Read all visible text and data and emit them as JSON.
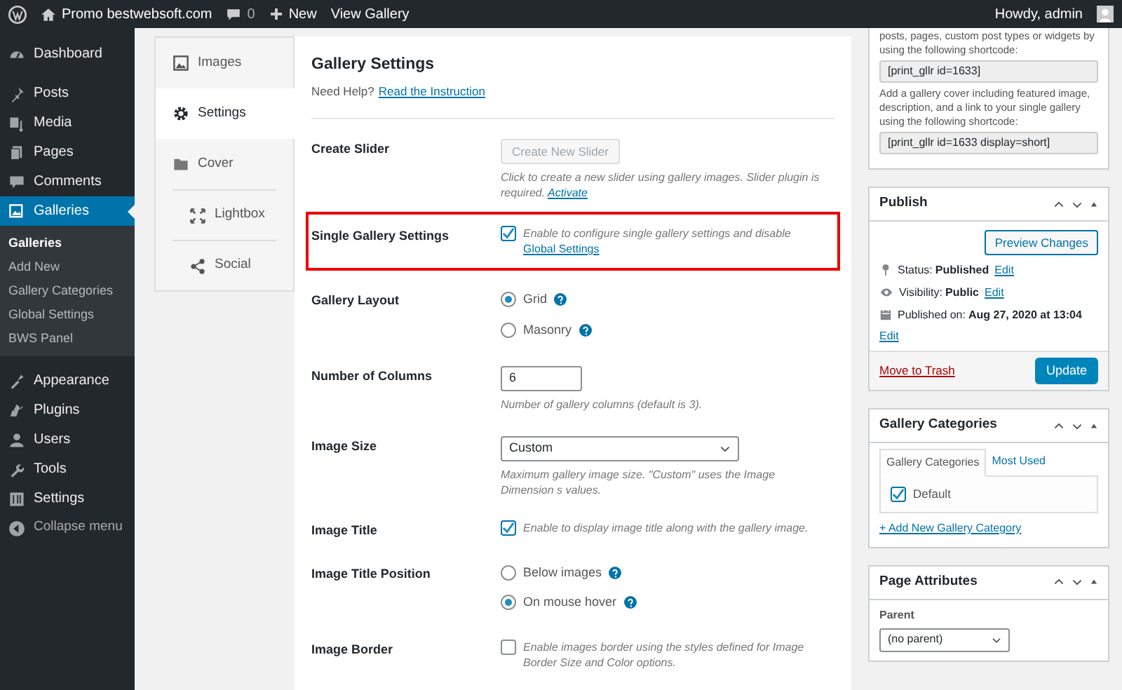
{
  "admin_bar": {
    "site": "Promo bestwebsoft.com",
    "comments": "0",
    "new": "New",
    "view": "View Gallery",
    "greeting": "Howdy, admin"
  },
  "menu_groups": [
    [
      {
        "label": "Dashboard",
        "selected": false
      }
    ],
    [
      {
        "label": "Posts",
        "selected": false
      },
      {
        "label": "Media",
        "selected": false
      },
      {
        "label": "Pages",
        "selected": false
      },
      {
        "label": "Comments",
        "selected": false
      },
      {
        "label": "Galleries",
        "selected": true,
        "children": [
          {
            "label": "Galleries",
            "selected": true
          },
          {
            "label": "Add New",
            "selected": false
          },
          {
            "label": "Gallery Categories",
            "selected": false
          },
          {
            "label": "Global Settings",
            "selected": false
          },
          {
            "label": "BWS Panel",
            "selected": false
          }
        ]
      }
    ],
    [
      {
        "label": "Appearance",
        "selected": false
      },
      {
        "label": "Plugins",
        "selected": false
      },
      {
        "label": "Users",
        "selected": false
      },
      {
        "label": "Tools",
        "selected": false
      },
      {
        "label": "Settings",
        "selected": false
      }
    ]
  ],
  "collapse": "Collapse menu",
  "tabs": [
    {
      "label": "Images",
      "selected": false
    },
    {
      "label": "Settings",
      "selected": true
    },
    {
      "label": "Cover",
      "selected": false
    },
    {
      "label": "Lightbox",
      "selected": false
    },
    {
      "label": "Social",
      "selected": false
    }
  ],
  "settings": {
    "title": "Gallery Settings",
    "help": "Need Help?",
    "help_link": "Read the Instruction",
    "rows": [
      {
        "label": "Create Slider",
        "kind": "button",
        "button": "Create New Slider",
        "disabled": true,
        "note": "Click to create a new slider using gallery images. Slider plugin is required.",
        "note_link": "Activate",
        "highlighted": false
      },
      {
        "label": "Single Gallery Settings",
        "kind": "checkbox",
        "checked": true,
        "text": "Enable to configure single gallery settings and disable",
        "link": "Global Settings",
        "highlighted": true
      },
      {
        "label": "Gallery Layout",
        "kind": "radio",
        "highlighted": false,
        "options": [
          {
            "label": "Grid",
            "selected": true
          },
          {
            "label": "Masonry",
            "selected": false
          }
        ]
      },
      {
        "label": "Number of Columns",
        "kind": "number",
        "value": "6",
        "note": "Number of gallery columns (default is 3).",
        "highlighted": false
      },
      {
        "label": "Image Size",
        "kind": "select",
        "value": "Custom",
        "note": "Maximum gallery image size. \"Custom\" uses the Image Dimension s values.",
        "highlighted": false
      },
      {
        "label": "Image Title",
        "kind": "checkbox",
        "checked": true,
        "text": "Enable to display image title along with the gallery image.",
        "highlighted": false
      },
      {
        "label": "Image Title Position",
        "kind": "radio",
        "highlighted": false,
        "options": [
          {
            "label": "Below images",
            "selected": false
          },
          {
            "label": "On mouse hover",
            "selected": true
          }
        ]
      },
      {
        "label": "Image Border",
        "kind": "checkbox",
        "checked": false,
        "text": "Enable images border using the styles defined for Image Border Size and Color options.",
        "highlighted": false
      }
    ]
  },
  "shortcodes": {
    "text_1": "posts, pages, custom post types or widgets by using the following shortcode:",
    "code_1": "[print_gllr id=1633]",
    "text_2": "Add a gallery cover including featured image, description, and a link to your single gallery using the following shortcode:",
    "code_2": "[print_gllr id=1633 display=short]"
  },
  "publish": {
    "title": "Publish",
    "preview": "Preview Changes",
    "status_label": "Status:",
    "status": "Published",
    "status_edit": "Edit",
    "visibility_label": "Visibility:",
    "visibility": "Public",
    "visibility_edit": "Edit",
    "date_label": "Published on:",
    "date": "Aug 27, 2020 at 13:04",
    "date_edit": "Edit",
    "trash": "Move to Trash",
    "update": "Update"
  },
  "categories": {
    "title": "Gallery Categories",
    "tabs": [
      {
        "label": "Gallery Categories",
        "selected": true
      },
      {
        "label": "Most Used",
        "selected": false
      }
    ],
    "items": [
      {
        "label": "Default",
        "checked": true
      }
    ],
    "add": "+ Add New Gallery Category"
  },
  "page_attributes": {
    "title": "Page Attributes",
    "parent_label": "Parent",
    "parent": "(no parent)"
  }
}
